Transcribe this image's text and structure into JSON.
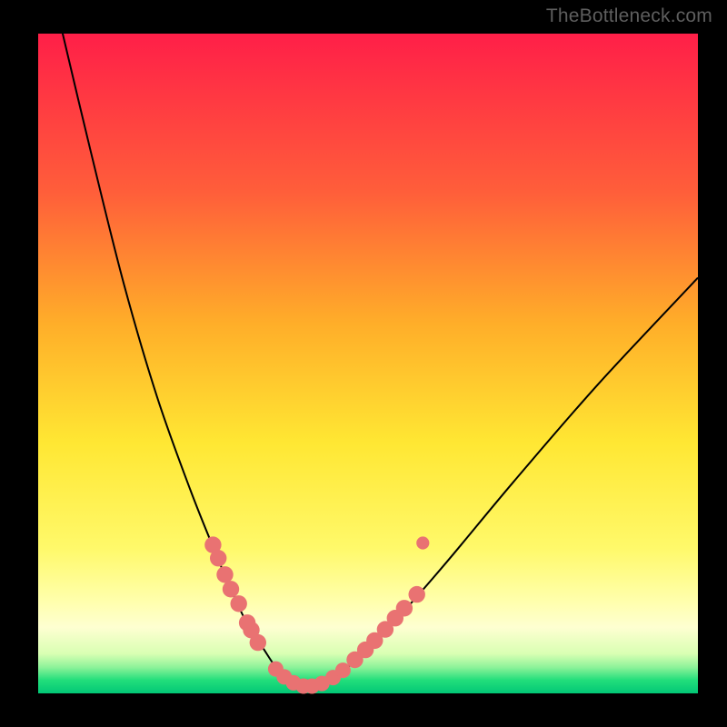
{
  "watermark": "TheBottleneck.com",
  "colors": {
    "frame": "#000000",
    "marker": "#E97272",
    "curve": "#000000",
    "gradient_stops": [
      {
        "pos": 0.0,
        "hex": "#FF1F48"
      },
      {
        "pos": 0.24,
        "hex": "#FF5E3A"
      },
      {
        "pos": 0.44,
        "hex": "#FFAE29"
      },
      {
        "pos": 0.62,
        "hex": "#FFE733"
      },
      {
        "pos": 0.78,
        "hex": "#FFF96A"
      },
      {
        "pos": 0.86,
        "hex": "#FFFFAC"
      },
      {
        "pos": 0.9,
        "hex": "#FEFFD1"
      },
      {
        "pos": 0.94,
        "hex": "#D9FFB3"
      },
      {
        "pos": 0.96,
        "hex": "#8FF39A"
      },
      {
        "pos": 0.98,
        "hex": "#22DE7B"
      },
      {
        "pos": 1.0,
        "hex": "#02C776"
      }
    ]
  },
  "chart_data": {
    "type": "line",
    "title": "",
    "xlabel": "",
    "ylabel": "",
    "xlim": [
      0,
      100
    ],
    "ylim": [
      0,
      100
    ],
    "note": "Axes have no visible tick labels; x and y are normalized 0–100 across the plot area. y=100 at top, y=0 at bottom (green). Curve is a V-shaped minimum near x≈40.",
    "series": [
      {
        "name": "bottleneck-curve",
        "x": [
          3,
          8,
          13,
          18,
          23,
          27,
          30,
          32,
          34,
          36,
          38,
          40,
          42,
          44,
          47,
          50,
          55,
          62,
          72,
          85,
          100
        ],
        "y": [
          103,
          82,
          62,
          45,
          31,
          21,
          14,
          10,
          7,
          4,
          2,
          1,
          1,
          2,
          4,
          7,
          12,
          20,
          32,
          47,
          63
        ]
      }
    ],
    "markers": [
      {
        "name": "left-cluster",
        "x": 26.5,
        "y": 22.5,
        "r": 1.3
      },
      {
        "name": "left-cluster",
        "x": 27.3,
        "y": 20.5,
        "r": 1.3
      },
      {
        "name": "left-cluster",
        "x": 28.3,
        "y": 18.0,
        "r": 1.3
      },
      {
        "name": "left-cluster",
        "x": 29.2,
        "y": 15.8,
        "r": 1.3
      },
      {
        "name": "left-cluster",
        "x": 30.4,
        "y": 13.6,
        "r": 1.3
      },
      {
        "name": "left-cluster",
        "x": 31.7,
        "y": 10.7,
        "r": 1.3
      },
      {
        "name": "left-cluster",
        "x": 32.3,
        "y": 9.6,
        "r": 1.3
      },
      {
        "name": "left-cluster",
        "x": 33.3,
        "y": 7.7,
        "r": 1.3
      },
      {
        "name": "bottom",
        "x": 36.0,
        "y": 3.7,
        "r": 1.2
      },
      {
        "name": "bottom",
        "x": 37.3,
        "y": 2.5,
        "r": 1.2
      },
      {
        "name": "bottom",
        "x": 38.7,
        "y": 1.6,
        "r": 1.2
      },
      {
        "name": "bottom",
        "x": 40.2,
        "y": 1.1,
        "r": 1.2
      },
      {
        "name": "bottom",
        "x": 41.5,
        "y": 1.1,
        "r": 1.2
      },
      {
        "name": "bottom",
        "x": 43.0,
        "y": 1.5,
        "r": 1.2
      },
      {
        "name": "bottom",
        "x": 44.7,
        "y": 2.4,
        "r": 1.2
      },
      {
        "name": "bottom",
        "x": 46.2,
        "y": 3.5,
        "r": 1.2
      },
      {
        "name": "right-cluster",
        "x": 48.0,
        "y": 5.1,
        "r": 1.3
      },
      {
        "name": "right-cluster",
        "x": 49.6,
        "y": 6.6,
        "r": 1.3
      },
      {
        "name": "right-cluster",
        "x": 51.0,
        "y": 8.0,
        "r": 1.3
      },
      {
        "name": "right-cluster",
        "x": 52.6,
        "y": 9.7,
        "r": 1.3
      },
      {
        "name": "right-cluster",
        "x": 54.1,
        "y": 11.4,
        "r": 1.3
      },
      {
        "name": "right-cluster",
        "x": 55.5,
        "y": 12.9,
        "r": 1.3
      },
      {
        "name": "right-cluster",
        "x": 57.4,
        "y": 15.0,
        "r": 1.3
      },
      {
        "name": "right-outlier",
        "x": 58.3,
        "y": 22.8,
        "r": 1.0
      }
    ]
  }
}
